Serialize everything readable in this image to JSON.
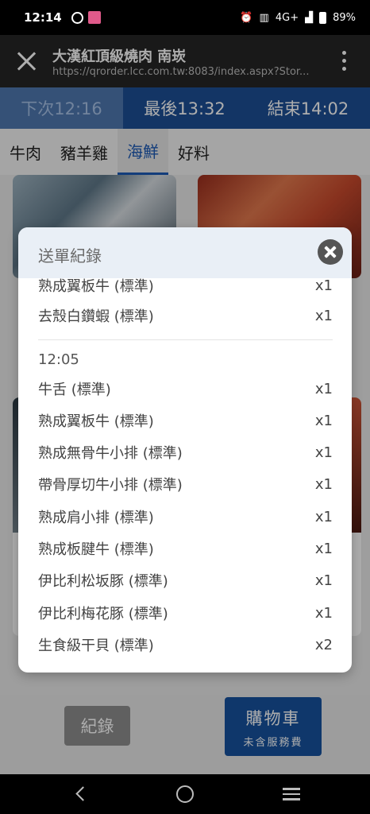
{
  "status_bar": {
    "time": "12:14",
    "network": "4G+",
    "battery": "89%"
  },
  "browser": {
    "title": "大漢紅頂級燒肉 南崁",
    "url": "https://qrorder.lcc.com.tw:8083/index.aspx?Stor..."
  },
  "times": {
    "next": "下次12:16",
    "last": "最後13:32",
    "end": "結束14:02"
  },
  "tabs": [
    {
      "label": "牛肉",
      "active": false
    },
    {
      "label": "豬羊雞",
      "active": false
    },
    {
      "label": "海鮮",
      "active": true
    },
    {
      "label": "好料",
      "active": false
    }
  ],
  "modal": {
    "title": "送單紀錄",
    "first_group": [
      {
        "name": "熟成翼板牛 (標準)",
        "qty": "x1"
      },
      {
        "name": "去殼白鑽蝦 (標準)",
        "qty": "x1"
      }
    ],
    "second_group_time": "12:05",
    "second_group": [
      {
        "name": "牛舌 (標準)",
        "qty": "x1"
      },
      {
        "name": "熟成翼板牛 (標準)",
        "qty": "x1"
      },
      {
        "name": "熟成無骨牛小排 (標準)",
        "qty": "x1"
      },
      {
        "name": "帶骨厚切牛小排 (標準)",
        "qty": "x1"
      },
      {
        "name": "熟成肩小排 (標準)",
        "qty": "x1"
      },
      {
        "name": "熟成板腱牛 (標準)",
        "qty": "x1"
      },
      {
        "name": "伊比利松坂豚 (標準)",
        "qty": "x1"
      },
      {
        "name": "伊比利梅花豚 (標準)",
        "qty": "x1"
      },
      {
        "name": "生食級干貝 (標準)",
        "qty": "x2"
      }
    ]
  },
  "bottom": {
    "record_label": "紀錄",
    "cart_label": "購物車",
    "cart_sub": "未含服務費"
  }
}
